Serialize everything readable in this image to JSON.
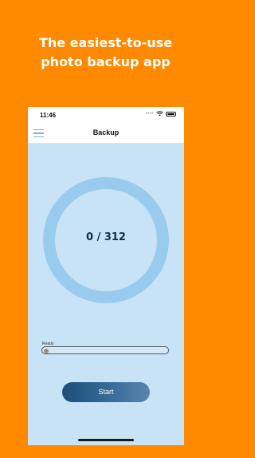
{
  "headline": {
    "line1": "The easiest-to-use",
    "line2": "photo backup app"
  },
  "status_bar": {
    "time": "11:46",
    "signal_icon": "signal-dots-icon",
    "wifi_icon": "wifi-icon",
    "battery_icon": "battery-icon"
  },
  "nav": {
    "title": "Backup",
    "menu_icon": "hamburger-menu-icon"
  },
  "backup": {
    "counter": "0 / 312",
    "done": 0,
    "total": 312
  },
  "progress": {
    "label": "Ready",
    "fraction": 0
  },
  "actions": {
    "start_label": "Start"
  },
  "colors": {
    "background": "#FF8A00",
    "screen": "#C9E3F6",
    "ring": "#99CBEE",
    "button": "#1B4E7A"
  }
}
